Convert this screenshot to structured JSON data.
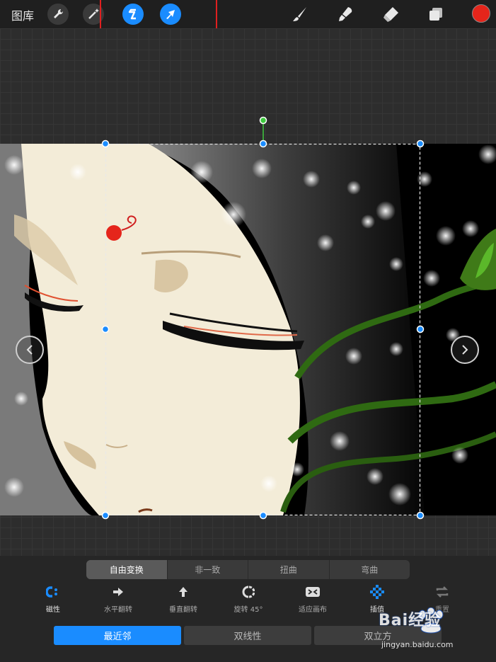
{
  "topbar": {
    "gallery_label": "图库",
    "icons": [
      "wrench-icon",
      "magic-wand-icon",
      "selection-s-icon",
      "transform-arrow-icon",
      "brush-icon",
      "smudge-icon",
      "eraser-icon",
      "layers-icon",
      "color-swatch"
    ],
    "current_color": "#e5251b",
    "accent": "#1a8cff"
  },
  "modes": [
    "自由变换",
    "非一致",
    "扭曲",
    "弯曲"
  ],
  "active_mode": "自由变换",
  "tools": {
    "magnetic": "磁性",
    "flip_h": "水平翻转",
    "flip_v": "垂直翻转",
    "rotate": "旋转 45°",
    "fit": "适应画布",
    "interpolation": "插值",
    "reset": "重置"
  },
  "interpolation_options": [
    "最近邻",
    "双线性",
    "双立方"
  ],
  "selected_interpolation": "最近邻",
  "watermark": {
    "brand": "Bai经验",
    "url": "jingyan.baidu.com"
  }
}
